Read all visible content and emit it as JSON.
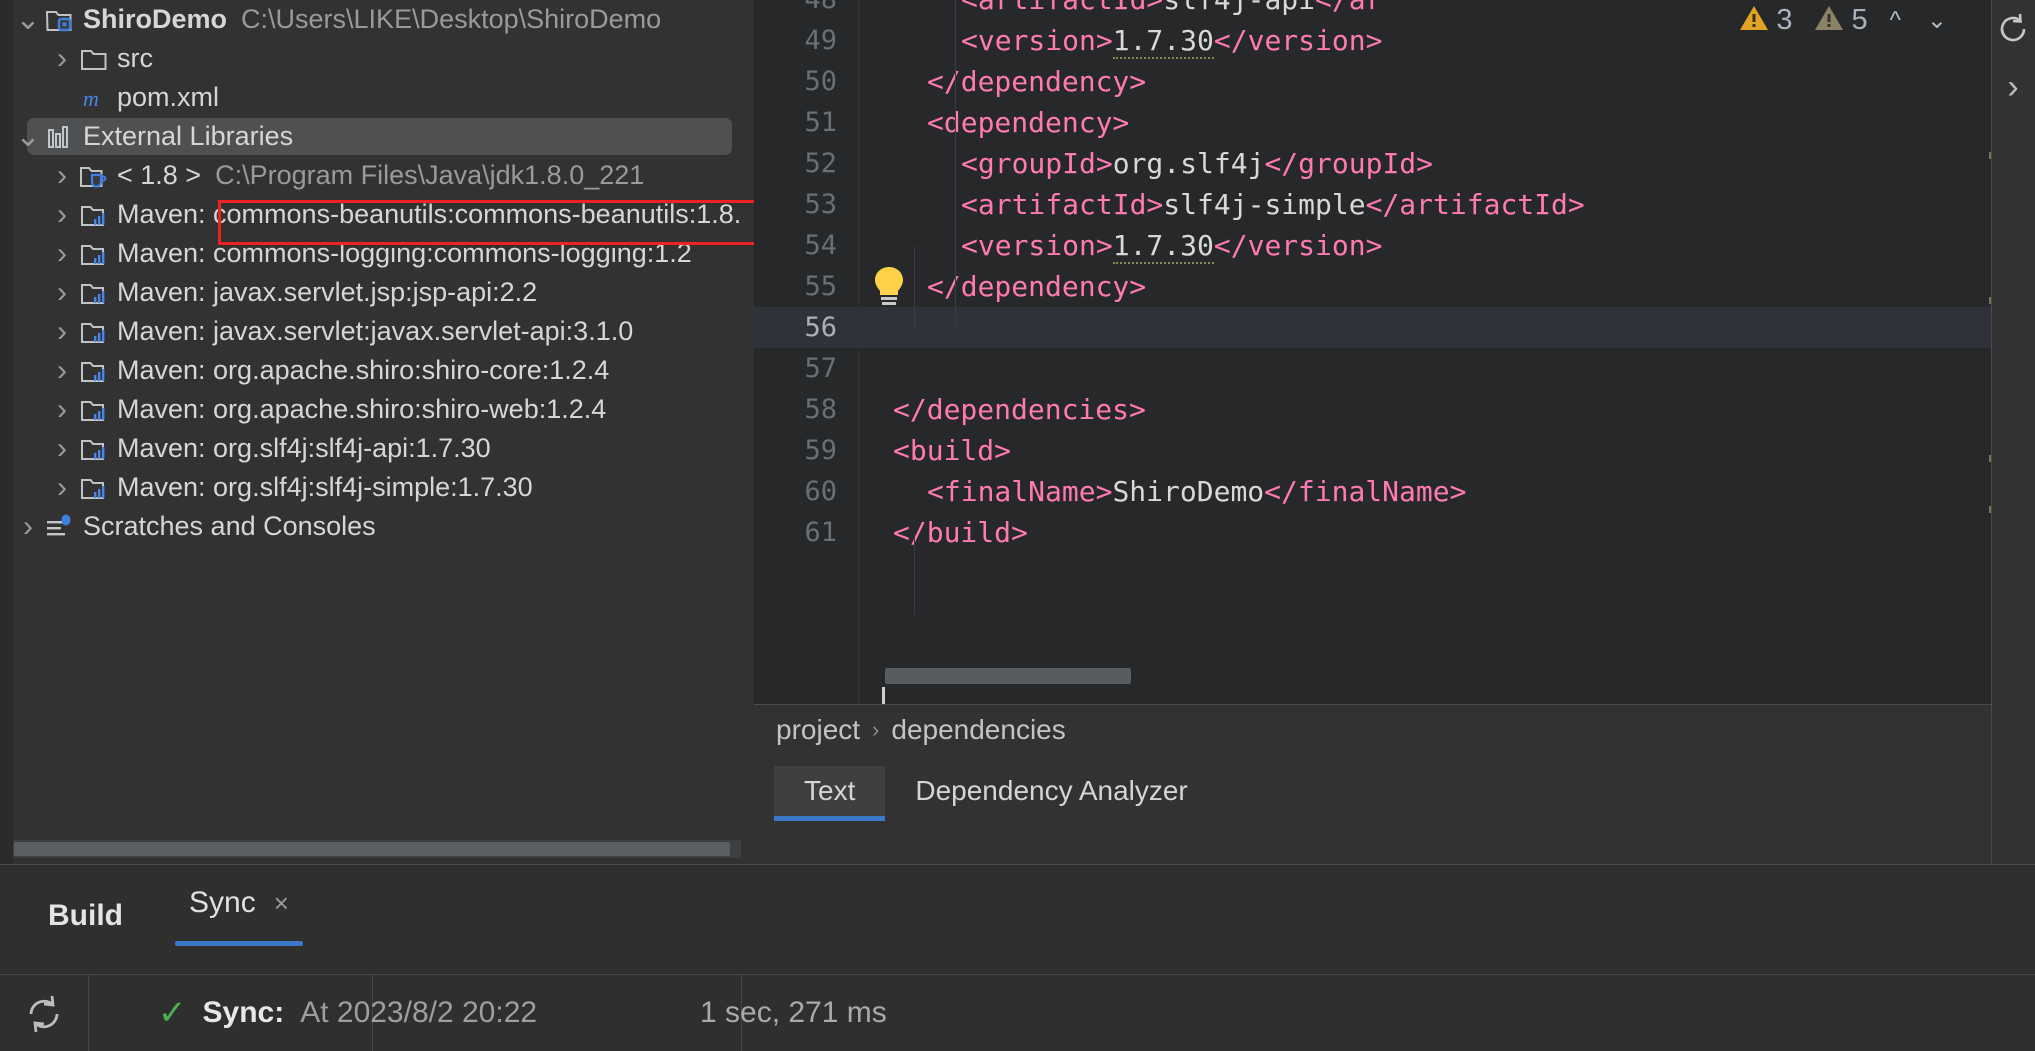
{
  "project_tree": {
    "rows": [
      {
        "id": "shirodemo",
        "arrow": "expanded",
        "icon": "module-icon",
        "label": "ShiroDemo",
        "bold": true,
        "path": "C:\\Users\\LIKE\\Desktop\\ShiroDemo",
        "indent": 1,
        "selected": false
      },
      {
        "id": "src",
        "arrow": "collapsed",
        "icon": "folder-icon",
        "label": "src",
        "bold": false,
        "path": "",
        "indent": 2,
        "selected": false
      },
      {
        "id": "pom-xml",
        "arrow": "none",
        "icon": "maven-m-icon",
        "label": "pom.xml",
        "bold": false,
        "path": "",
        "indent": 2,
        "selected": false
      },
      {
        "id": "external-libraries",
        "arrow": "expanded",
        "icon": "library-icon",
        "label": "External Libraries",
        "bold": false,
        "path": "",
        "indent": 1,
        "selected": true
      },
      {
        "id": "jdk",
        "arrow": "collapsed",
        "icon": "jdk-icon",
        "label": "< 1.8 >",
        "bold": false,
        "path": "C:\\Program Files\\Java\\jdk1.8.0_221",
        "indent": 2,
        "selected": false
      },
      {
        "id": "maven-commons-beanutils",
        "arrow": "collapsed",
        "icon": "maven-lib-icon",
        "label": "Maven: commons-beanutils:commons-beanutils:1.8.",
        "bold": false,
        "path": "",
        "indent": 2,
        "selected": false
      },
      {
        "id": "maven-commons-logging",
        "arrow": "collapsed",
        "icon": "maven-lib-icon",
        "label": "Maven: commons-logging:commons-logging:1.2",
        "bold": false,
        "path": "",
        "indent": 2,
        "selected": false
      },
      {
        "id": "maven-jsp-api",
        "arrow": "collapsed",
        "icon": "maven-lib-icon",
        "label": "Maven: javax.servlet.jsp:jsp-api:2.2",
        "bold": false,
        "path": "",
        "indent": 2,
        "selected": false
      },
      {
        "id": "maven-servlet-api",
        "arrow": "collapsed",
        "icon": "maven-lib-icon",
        "label": "Maven: javax.servlet:javax.servlet-api:3.1.0",
        "bold": false,
        "path": "",
        "indent": 2,
        "selected": false
      },
      {
        "id": "maven-shiro-core",
        "arrow": "collapsed",
        "icon": "maven-lib-icon",
        "label": "Maven: org.apache.shiro:shiro-core:1.2.4",
        "bold": false,
        "path": "",
        "indent": 2,
        "selected": false
      },
      {
        "id": "maven-shiro-web",
        "arrow": "collapsed",
        "icon": "maven-lib-icon",
        "label": "Maven: org.apache.shiro:shiro-web:1.2.4",
        "bold": false,
        "path": "",
        "indent": 2,
        "selected": false
      },
      {
        "id": "maven-slf4j-api",
        "arrow": "collapsed",
        "icon": "maven-lib-icon",
        "label": "Maven: org.slf4j:slf4j-api:1.7.30",
        "bold": false,
        "path": "",
        "indent": 2,
        "selected": false
      },
      {
        "id": "maven-slf4j-simple",
        "arrow": "collapsed",
        "icon": "maven-lib-icon",
        "label": "Maven: org.slf4j:slf4j-simple:1.7.30",
        "bold": false,
        "path": "",
        "indent": 2,
        "selected": false
      },
      {
        "id": "scratches-and-consoles",
        "arrow": "collapsed",
        "icon": "scratches-icon",
        "label": "Scratches and Consoles",
        "bold": false,
        "path": "",
        "indent": 1,
        "selected": false
      }
    ],
    "highlight_note": "red-annotation-box-around-commons-beanutils"
  },
  "editor": {
    "lines": [
      {
        "num": "48",
        "indent": 3,
        "partial": true,
        "segments": [
          {
            "t": "<artifactId>",
            "c": "tag"
          },
          {
            "t": "slf4j-api",
            "c": "txt"
          },
          {
            "t": "</ar",
            "c": "tag"
          }
        ]
      },
      {
        "num": "49",
        "indent": 3,
        "partial": false,
        "segments": [
          {
            "t": "<version>",
            "c": "tag"
          },
          {
            "t": "1.7.30",
            "c": "txt squig"
          },
          {
            "t": "</version>",
            "c": "tag"
          }
        ]
      },
      {
        "num": "50",
        "indent": 2,
        "partial": false,
        "segments": [
          {
            "t": "</dependency>",
            "c": "tag"
          }
        ]
      },
      {
        "num": "51",
        "indent": 2,
        "partial": false,
        "segments": [
          {
            "t": "<dependency>",
            "c": "tag"
          }
        ]
      },
      {
        "num": "52",
        "indent": 3,
        "partial": false,
        "segments": [
          {
            "t": "<groupId>",
            "c": "tag"
          },
          {
            "t": "org.slf4j",
            "c": "txt"
          },
          {
            "t": "</groupId>",
            "c": "tag"
          }
        ]
      },
      {
        "num": "53",
        "indent": 3,
        "partial": false,
        "segments": [
          {
            "t": "<artifactId>",
            "c": "tag"
          },
          {
            "t": "slf4j-simple",
            "c": "txt"
          },
          {
            "t": "</artifactId>",
            "c": "tag"
          }
        ]
      },
      {
        "num": "54",
        "indent": 3,
        "partial": false,
        "segments": [
          {
            "t": "<version>",
            "c": "tag"
          },
          {
            "t": "1.7.30",
            "c": "txt squig"
          },
          {
            "t": "</version>",
            "c": "tag"
          }
        ]
      },
      {
        "num": "55",
        "indent": 2,
        "partial": false,
        "segments": [
          {
            "t": "</dependency>",
            "c": "tag"
          }
        ]
      },
      {
        "num": "56",
        "indent": 2,
        "partial": false,
        "current": true,
        "segments": []
      },
      {
        "num": "57",
        "indent": 2,
        "partial": false,
        "segments": []
      },
      {
        "num": "58",
        "indent": 1,
        "partial": false,
        "segments": [
          {
            "t": "</dependencies>",
            "c": "tag"
          }
        ]
      },
      {
        "num": "59",
        "indent": 1,
        "partial": false,
        "segments": [
          {
            "t": "<build>",
            "c": "tag"
          }
        ]
      },
      {
        "num": "60",
        "indent": 2,
        "partial": false,
        "segments": [
          {
            "t": "<finalName>",
            "c": "tag"
          },
          {
            "t": "ShiroDemo",
            "c": "txt"
          },
          {
            "t": "</finalName>",
            "c": "tag"
          }
        ]
      },
      {
        "num": "61",
        "indent": 1,
        "partial": false,
        "segments": [
          {
            "t": "</build>",
            "c": "tag"
          }
        ]
      }
    ],
    "inspections": {
      "warning_icon": "warning-triangle-icon",
      "warning_count": "3",
      "weak_warning_icon": "weak-warning-triangle-icon",
      "weak_warning_count": "5",
      "prev_icon": "chevron-up-icon",
      "next_icon": "chevron-down-icon"
    },
    "intention_bulb": "lightbulb-icon",
    "caret_line": "56"
  },
  "breadcrumb": {
    "items": [
      "project",
      "dependencies"
    ],
    "separator": "›"
  },
  "editor_tabs": {
    "items": [
      {
        "label": "Text",
        "active": true
      },
      {
        "label": "Dependency Analyzer",
        "active": false
      }
    ]
  },
  "right_stripe": {
    "icons": [
      {
        "name": "reload-icon",
        "glyph": "⟳"
      },
      {
        "name": "expand-right-icon",
        "glyph": "›"
      }
    ]
  },
  "build_panel": {
    "title": "Build",
    "tabs": [
      {
        "label": "Sync",
        "close_icon": "close-icon",
        "close_glyph": "×",
        "active": true
      }
    ],
    "toolbar": {
      "refresh_icon": "refresh-icon"
    },
    "status": {
      "state_icon": "success-check-icon",
      "label": "Sync:",
      "detail": "At 2023/8/2 20:22",
      "duration": "1 sec, 271 ms"
    }
  },
  "colors": {
    "sidebar_bg": "#323232",
    "editor_bg": "#262829",
    "tag_pink": "#ff7ab2",
    "accent_blue": "#3c78c8",
    "success_green": "#4caf50",
    "warning_yellow": "#c99a17",
    "annotation_red": "#ee2222",
    "selection_grey": "#4e5052"
  }
}
